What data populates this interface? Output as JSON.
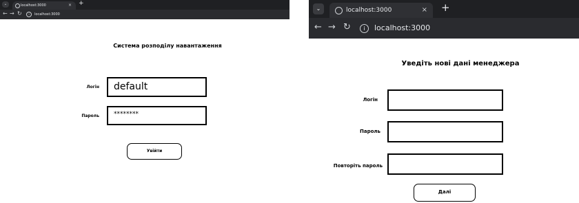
{
  "left_window": {
    "tab_title": "localhost:3000",
    "url": "localhost:3000",
    "page_title": "Система розподілу навантаження",
    "login_label": "Логін",
    "login_value": "default",
    "password_label": "Пароль",
    "password_value": "********",
    "submit_label": "Увійти"
  },
  "right_window": {
    "tab_title": "localhost:3000",
    "url": "localhost:3000",
    "page_title": "Уведіть нові дані менеджера",
    "login_label": "Логін",
    "login_value": "",
    "password_label": "Пароль",
    "password_value": "",
    "repeat_password_label": "Повторіть пароль",
    "repeat_password_value": "",
    "next_label": "Далі"
  },
  "chrome_icons": [
    "tab-list-icon",
    "globe-icon",
    "close-icon",
    "new-tab-icon",
    "back-icon",
    "forward-icon",
    "reload-icon",
    "site-info-icon"
  ],
  "colors": {
    "tabbar": "#1f2023",
    "toolbar": "#2a2b2f",
    "tab": "#2f3034",
    "page": "#ffffff"
  }
}
